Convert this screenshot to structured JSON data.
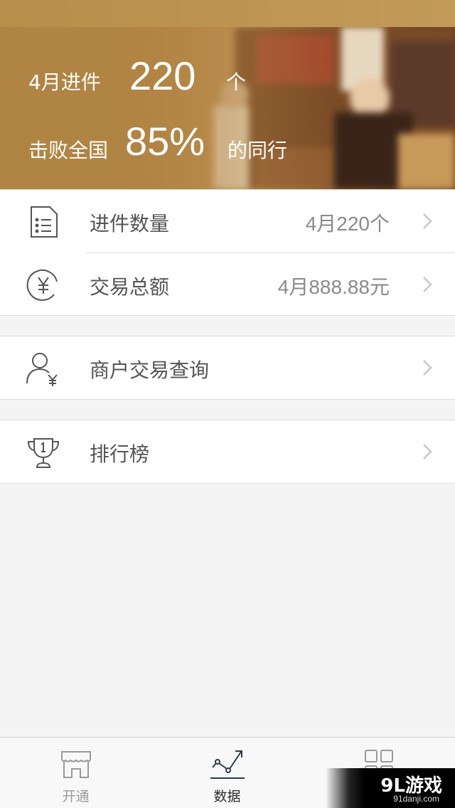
{
  "banner": {
    "line1_prefix": "4月进件",
    "line1_number": "220",
    "line1_suffix": "个",
    "line2_prefix": "击败全国",
    "line2_number": "85%",
    "line2_suffix": "的同行"
  },
  "stats": [
    {
      "label": "进件数量",
      "value": "4月220个",
      "icon": "document-list-icon"
    },
    {
      "label": "交易总额",
      "value": "4月888.88元",
      "icon": "yen-circle-icon"
    }
  ],
  "merchant_query": {
    "label": "商户交易查询",
    "icon": "user-yen-icon"
  },
  "ranking": {
    "label": "排行榜",
    "icon": "trophy-icon"
  },
  "tabs": [
    {
      "label": "开通",
      "icon": "storefront-icon",
      "active": false
    },
    {
      "label": "数据",
      "icon": "trend-chart-icon",
      "active": true
    },
    {
      "label": "",
      "icon": "grid-icon",
      "active": false
    }
  ],
  "watermark": {
    "title": "9L游戏",
    "url": "91danji.com"
  },
  "colors": {
    "banner": "#b0843f",
    "text_primary": "#555555",
    "text_secondary": "#8a8a8a",
    "background": "#f4f4f4"
  }
}
